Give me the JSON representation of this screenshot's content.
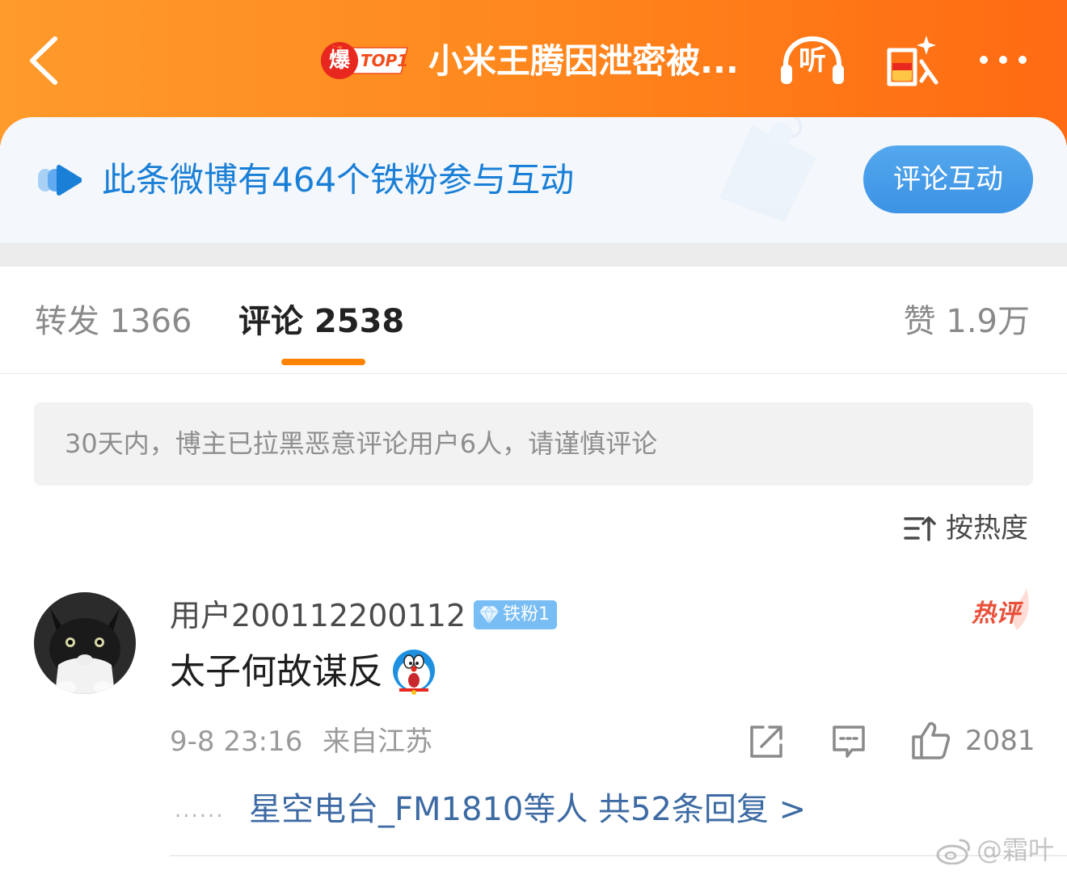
{
  "header": {
    "hot_badge_char": "爆",
    "hot_badge_rank": "TOP1",
    "title": "小米王腾因泄密被...",
    "listen_label": "听"
  },
  "fan_banner": {
    "text": "此条微博有464个铁粉参与互动",
    "button_label": "评论互动"
  },
  "tabs": [
    {
      "label": "转发 1366",
      "active": false
    },
    {
      "label": "评论 2538",
      "active": true
    },
    {
      "label": "赞 1.9万",
      "active": false
    }
  ],
  "notice": "30天内，博主已拉黑恶意评论用户6人，请谨慎评论",
  "sort_label": "按热度",
  "comment": {
    "username": "用户200112200112",
    "fan_badge": "铁粉1",
    "hot_tag": "热评",
    "text": "太子何故谋反",
    "time": "9-8 23:16",
    "location": "来自江苏",
    "like_count": "2081",
    "reply_summary": "星空电台_FM1810等人  共52条回复 >"
  },
  "watermark": "@霜叶",
  "colors": {
    "header_start": "#ff9a2b",
    "header_end": "#ff6a12",
    "tab_underline": "#ff8200",
    "banner_text": "#1a7fd6",
    "link_blue": "#3d6aa3",
    "hot_red": "#e8503a"
  },
  "icons": [
    "back-arrow-icon",
    "listen-icon",
    "red-packet-icon",
    "more-icon",
    "fan-interact-icon",
    "sort-icon",
    "share-icon",
    "reply-icon",
    "like-icon",
    "doraemon-emoji-icon",
    "weibo-logo-icon"
  ]
}
